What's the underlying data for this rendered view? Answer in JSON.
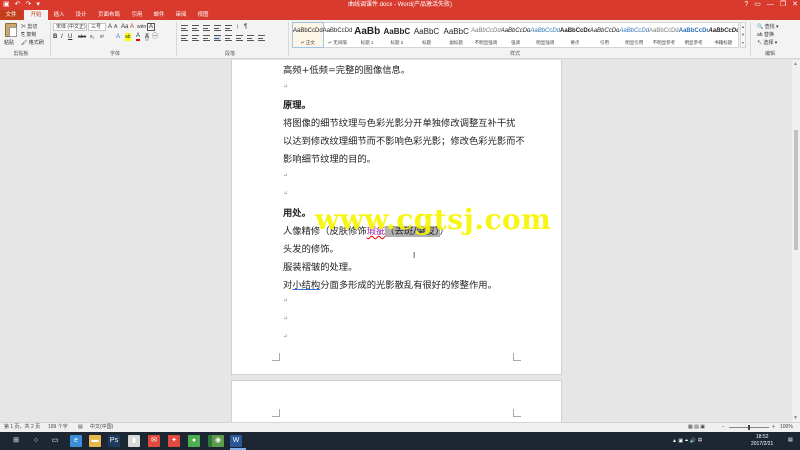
{
  "window": {
    "title": "曲线调课件.docx - Word(产品激活失败)",
    "qat": [
      "save-icon",
      "undo-icon",
      "redo-icon",
      "customize-icon"
    ],
    "controls": [
      "help-icon",
      "ribbon-options-icon",
      "minimize-icon",
      "restore-icon",
      "close-icon"
    ],
    "qat_glyphs": [
      "▣",
      "↶",
      "↷",
      "▾"
    ],
    "control_glyphs": [
      "?",
      "▭",
      "—",
      "❐",
      "✕"
    ]
  },
  "tabs": [
    "文件",
    "开始",
    "插入",
    "设计",
    "页面布局",
    "引用",
    "邮件",
    "审阅",
    "视图"
  ],
  "ribbon": {
    "clipboard": {
      "paste": "粘贴",
      "cut": "✂ 剪切",
      "copy": "⎘ 复制",
      "painter": "🖌 格式刷",
      "label": "剪贴板"
    },
    "font": {
      "name": "宋体 (中文正)",
      "size": "三号",
      "grow": "A",
      "shrink": "A",
      "case": "Aa",
      "clear": "A",
      "pinyin": "wén",
      "border": "A",
      "bold": "B",
      "italic": "I",
      "underline": "U",
      "strike": "abc",
      "subscript": "x₂",
      "superscript": "x²",
      "effects": "A",
      "highlight": "ab",
      "color": "A",
      "shade": "A",
      "encircle": "㊀",
      "label": "字体"
    },
    "paragraph_label": "段落",
    "paragraph_extras": [
      "↕",
      "¶"
    ],
    "styles": [
      {
        "sample": "AaBbCcDd",
        "name": "↵ 正文"
      },
      {
        "sample": "AaBbCcDd",
        "name": "↵ 无间隔"
      },
      {
        "sample": "AaBb",
        "name": "标题 1"
      },
      {
        "sample": "AaBbC",
        "name": "标题 2"
      },
      {
        "sample": "AaBbC",
        "name": "标题"
      },
      {
        "sample": "AaBbC",
        "name": "副标题"
      },
      {
        "sample": "AaBbCcDd",
        "name": "不明显强调"
      },
      {
        "sample": "AaBbCcDd",
        "name": "强调"
      },
      {
        "sample": "AaBbCcDd",
        "name": "明显强调"
      },
      {
        "sample": "AaBbCcDd",
        "name": "要点"
      },
      {
        "sample": "AaBbCcDd",
        "name": "引用"
      },
      {
        "sample": "AaBbCcDd",
        "name": "明显引用"
      },
      {
        "sample": "AaBbCcDd",
        "name": "不明显参考"
      },
      {
        "sample": "AaBbCcDd",
        "name": "明显参考"
      },
      {
        "sample": "AaBbCcDd",
        "name": "书籍标题"
      }
    ],
    "styles_label": "样式",
    "gallery_scroll": [
      "▲",
      "▼",
      "▾"
    ],
    "editing": {
      "find": "🔍 查找 ▾",
      "replace": "ab 替换",
      "select": "↖ 选择 ▾",
      "label": "编辑"
    }
  },
  "document": {
    "page1_lines": [
      {
        "text": "高频+低频=完整的图像信息。",
        "bold": false
      },
      {
        "text": "↵",
        "bold": false
      },
      {
        "text": "原理。",
        "bold": true
      },
      {
        "text": "将图像的细节纹理与色彩光影分开单独修改调整互补干扰",
        "bold": false
      },
      {
        "text": "以达到修改纹理细节而不影响色彩光影；修改色彩光影而不",
        "bold": false
      },
      {
        "text": "影响细节纹理的目的。",
        "bold": false
      },
      {
        "text": "↵",
        "bold": false
      },
      {
        "text": "↵",
        "bold": false
      },
      {
        "text": "用处。",
        "bold": true
      }
    ],
    "line_skin": {
      "pre": "人像精修（皮肤修饰",
      "marked": "瑕疵",
      "highlighted": "（去斑/磨皮）",
      "post": "）"
    },
    "line_hair": "头发的修饰。",
    "line_clothes": "服装褶皱的处理。",
    "line_structure": {
      "pre": "对",
      "under": "小结构",
      "post": "分面多形成的光影散乱有很好的修整作用。"
    },
    "trailing_marks": [
      "↵",
      "↵",
      "↵"
    ],
    "watermark": "www.cgtsj.com",
    "text_cursor": "I"
  },
  "scrollbar_arrows": [
    "▲",
    "▼"
  ],
  "statusbar": {
    "page": "第 1 页，共 2 页",
    "words": "199 个字",
    "proof_icon": "▤",
    "language": "中文(中国)",
    "view_icons": "▦ ▤ ▣",
    "zoom_out": "−",
    "zoom_in": "+",
    "zoom": "100%"
  },
  "taskbar": {
    "apps": [
      {
        "icon": "start-icon",
        "glyph": "⊞",
        "color": "#ffffff"
      },
      {
        "icon": "cortana-icon",
        "glyph": "○",
        "color": "#ffffff"
      },
      {
        "icon": "task-view-icon",
        "glyph": "▭",
        "color": "#ffffff"
      },
      {
        "icon": "edge-icon",
        "glyph": "e",
        "color": "#3b8ed8"
      },
      {
        "icon": "explorer-icon",
        "glyph": "▬",
        "color": "#e8b84a"
      },
      {
        "icon": "photoshop-icon",
        "glyph": "Ps",
        "color": "#1e3a5f"
      },
      {
        "icon": "bookmark-icon",
        "glyph": "▮",
        "color": "#d9d9d9"
      },
      {
        "icon": "store-icon",
        "glyph": "✉",
        "color": "#e04a3f"
      },
      {
        "icon": "app-icon",
        "glyph": "✦",
        "color": "#e04a3f"
      },
      {
        "icon": "chat-icon",
        "glyph": "●",
        "color": "#4caf50"
      },
      {
        "icon": "download-icon",
        "glyph": "⬇",
        "color": "#2f7a3a"
      },
      {
        "icon": "game-icon",
        "glyph": "◉",
        "color": "#5c9c4a"
      },
      {
        "icon": "word-icon",
        "glyph": "W",
        "color": "#2b579a"
      }
    ],
    "tray_icons": "▲ ▣ ⏶ 🔊 中",
    "time": "18:52",
    "date": "2017/2/21",
    "notify": "▤"
  }
}
